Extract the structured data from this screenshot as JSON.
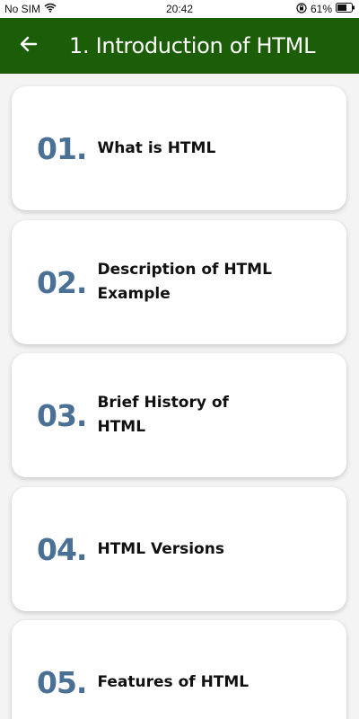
{
  "status_bar": {
    "carrier": "No SIM",
    "time": "20:42",
    "battery": "61%"
  },
  "app_bar": {
    "title": "1. Introduction of HTML"
  },
  "items": [
    {
      "number": "01.",
      "label": "What is HTML"
    },
    {
      "number": "02.",
      "label": "Description of HTML Example"
    },
    {
      "number": "03.",
      "label": "Brief History of HTML"
    },
    {
      "number": "04.",
      "label": "HTML Versions"
    },
    {
      "number": "05.",
      "label": "Features of HTML"
    }
  ],
  "colors": {
    "app_bar": "#1b5e07",
    "number": "#4a7096",
    "background": "#f4f4f4"
  }
}
